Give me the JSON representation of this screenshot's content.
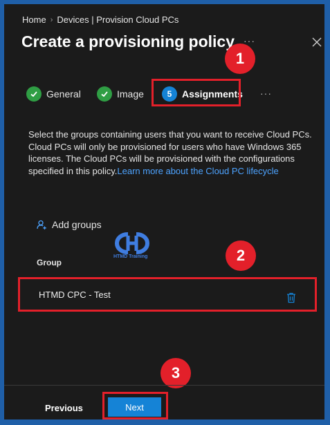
{
  "breadcrumb": {
    "home": "Home",
    "current": "Devices | Provision Cloud PCs"
  },
  "page_title": "Create a provisioning policy",
  "more_menu": "···",
  "steps": [
    {
      "label": "General",
      "status": "complete"
    },
    {
      "label": "Image",
      "status": "complete"
    },
    {
      "label": "Assignments",
      "number": "5",
      "status": "active"
    }
  ],
  "steps_more": "···",
  "description": {
    "text": "Select the groups containing users that you want to receive Cloud PCs. Cloud PCs will only be provisioned for users who have Windows 365 licenses. The Cloud PCs will be provisioned with the configurations specified in this policy.",
    "link": "Learn more about the Cloud PC lifecycle"
  },
  "add_groups_label": "Add groups",
  "watermark": {
    "text": "HTMD Training",
    "logo_letters": "CHD"
  },
  "table": {
    "column_header": "Group",
    "rows": [
      {
        "name": "HTMD CPC - Test"
      }
    ]
  },
  "buttons": {
    "previous": "Previous",
    "next": "Next"
  },
  "annotations": [
    "1",
    "2",
    "3"
  ],
  "colors": {
    "accent": "#1583d6",
    "highlight": "#e3202a",
    "check": "#2f9e44",
    "background": "#1b1b1b"
  }
}
